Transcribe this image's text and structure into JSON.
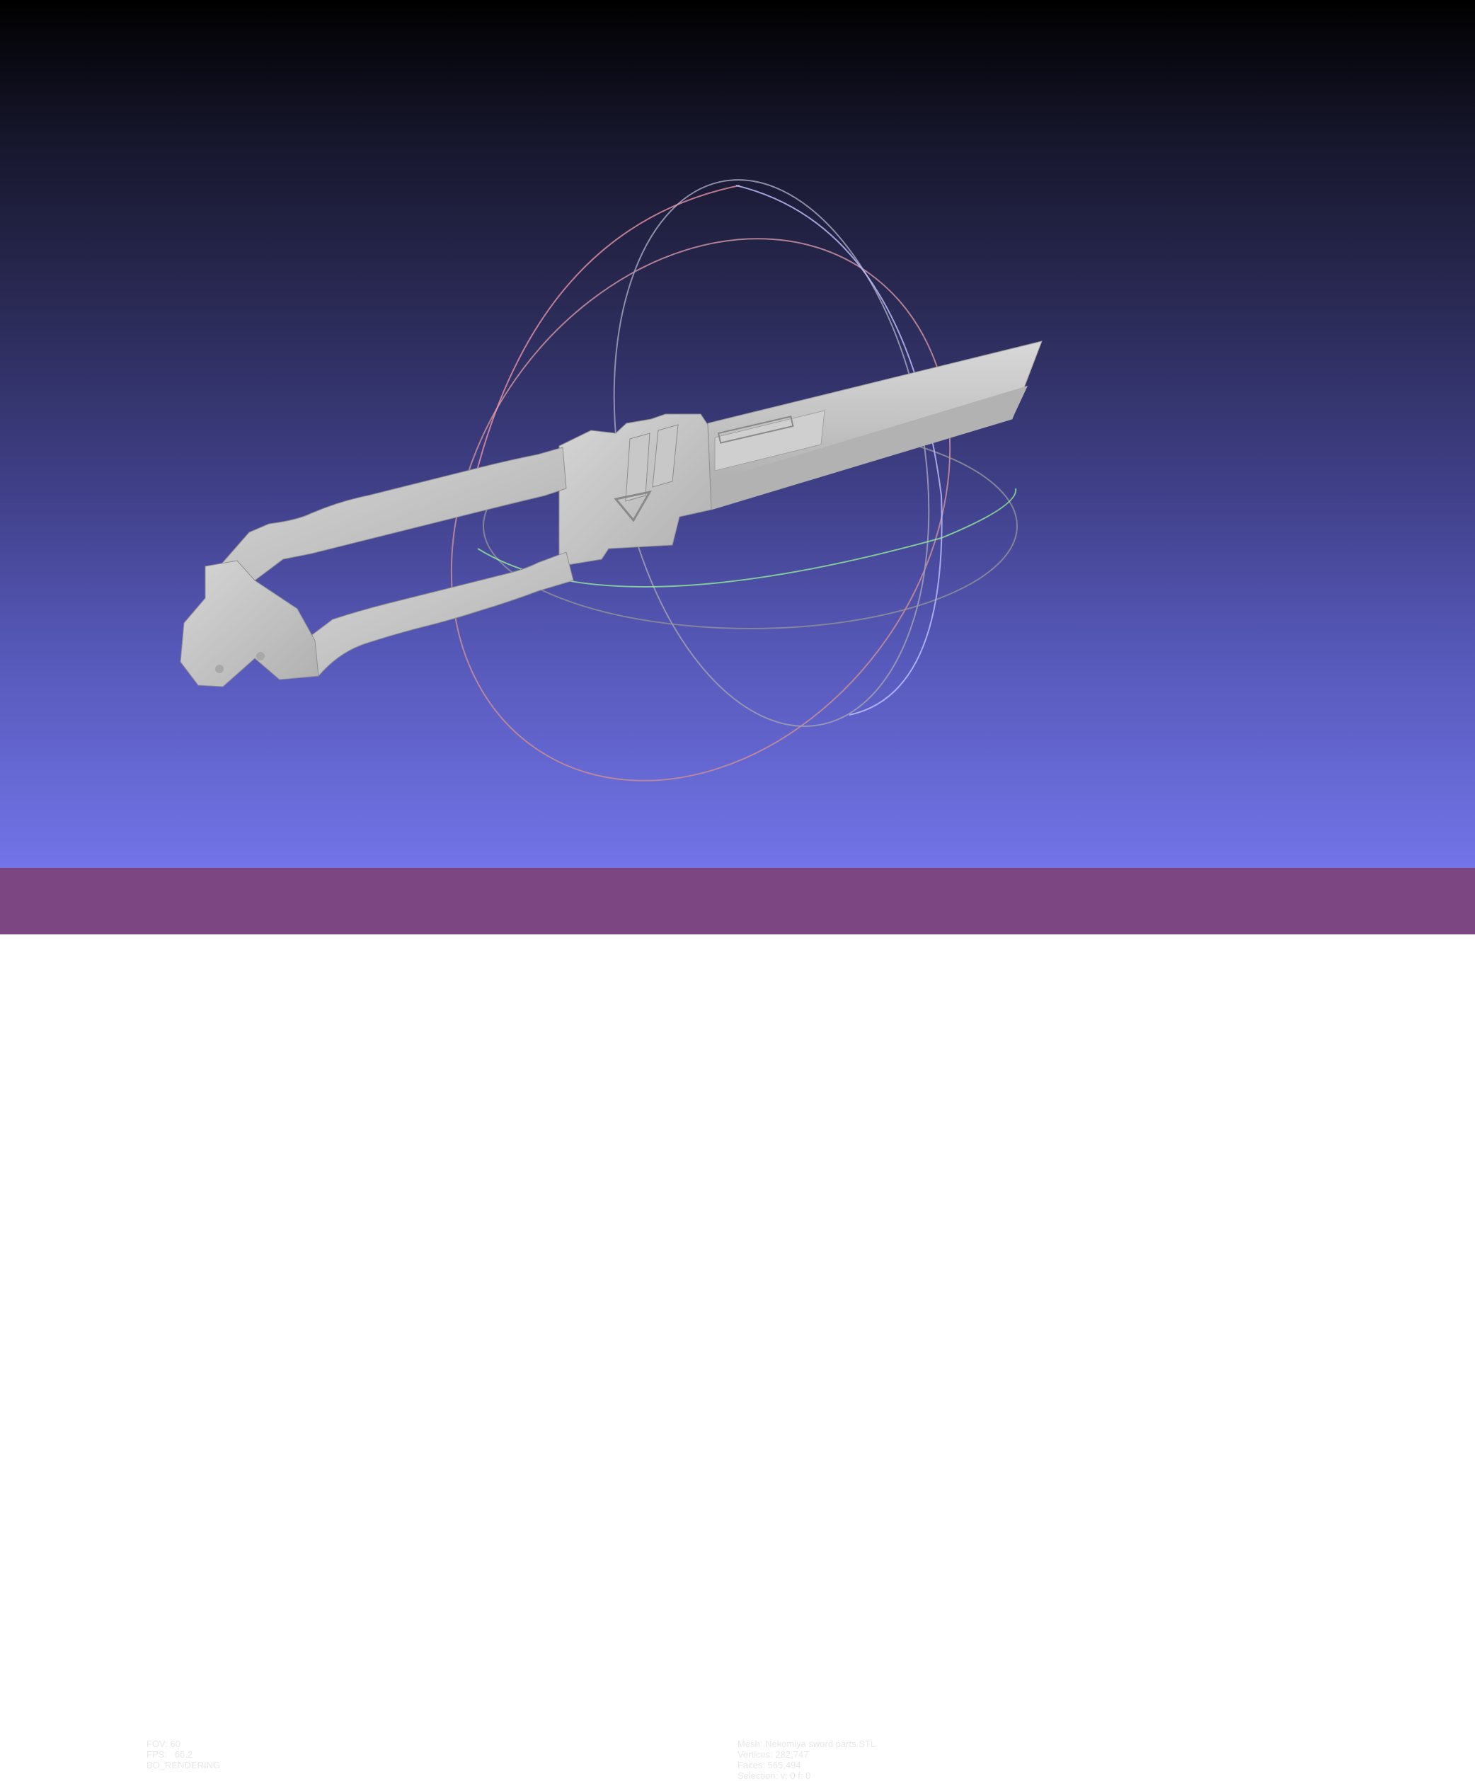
{
  "viewer": {
    "left_info": {
      "fov": "FOV: 60",
      "fps": "FPS:   66.2",
      "mode": "BO_RENDERING"
    },
    "right_info": {
      "mesh": "Mesh: Nekomiya sword parts.STL",
      "vertices": "Vertices: 282,747",
      "faces": "Faces: 565,494",
      "selection": "Selection: v: 0 f: 0"
    }
  },
  "colors": {
    "bg_top": "#000000",
    "bg_bottom": "#7274e8",
    "statusbar": "#7c4682",
    "model": "#c4c4c4",
    "trackball_x": "#ff8080",
    "trackball_y": "#80ff80",
    "trackball_z": "#a0a0ff"
  }
}
